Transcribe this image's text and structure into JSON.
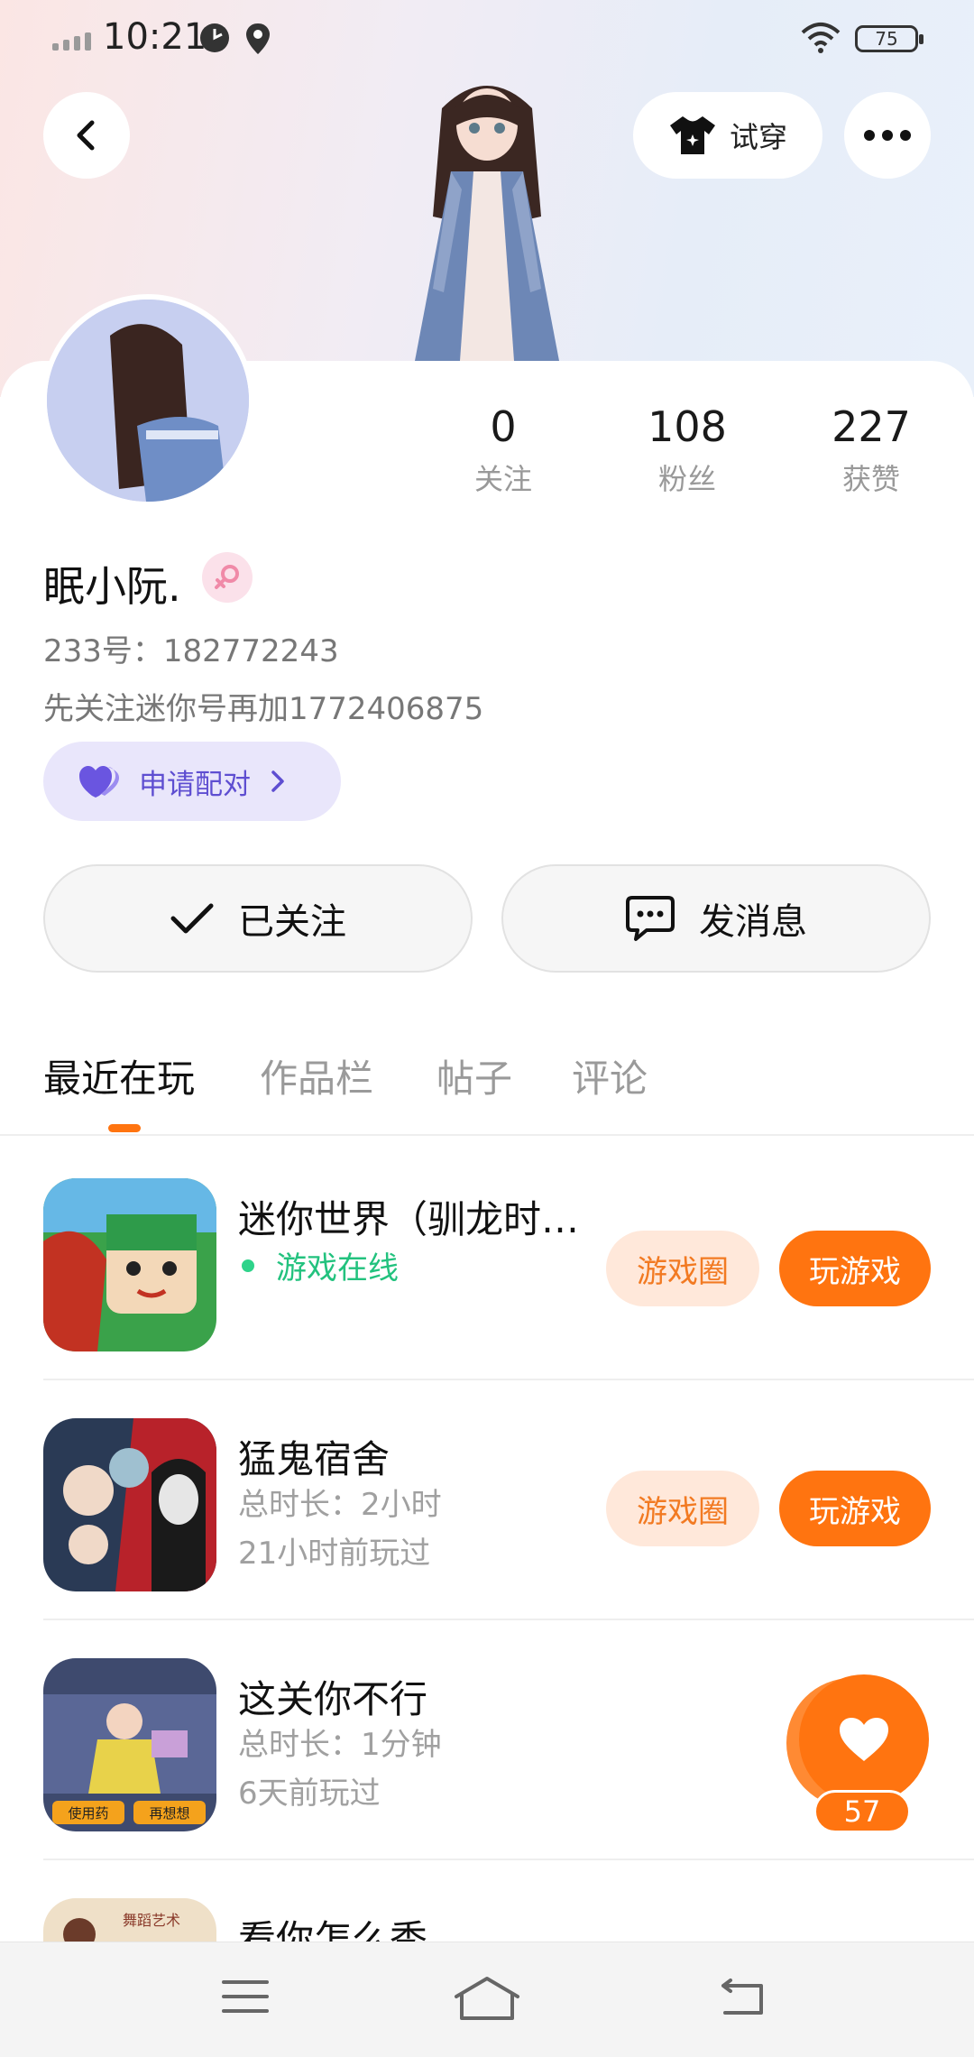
{
  "status_bar": {
    "time": "10:21",
    "battery": "75",
    "icons": [
      "signal-icon",
      "clock-icon",
      "location-icon",
      "wifi-icon",
      "battery-icon"
    ]
  },
  "header": {
    "back_icon": "chevron-left-icon",
    "try_on_label": "试穿",
    "try_on_icon": "tshirt-icon",
    "more_icon": "more-dots-icon"
  },
  "profile": {
    "nickname": "眠小阮.",
    "gender_icon": "female-icon",
    "id_line": "233号：182772243",
    "bio": "先关注迷你号再加1772406875",
    "pair_button": "申请配对",
    "stats": [
      {
        "value": "0",
        "label": "关注"
      },
      {
        "value": "108",
        "label": "粉丝"
      },
      {
        "value": "227",
        "label": "获赞"
      }
    ]
  },
  "actions": {
    "followed_label": "已关注",
    "message_label": "发消息"
  },
  "tabs": [
    {
      "label": "最近在玩",
      "active": true
    },
    {
      "label": "作品栏",
      "active": false
    },
    {
      "label": "帖子",
      "active": false
    },
    {
      "label": "评论",
      "active": false
    }
  ],
  "games": [
    {
      "title": "迷你世界（驯龙时…",
      "status": "游戏在线",
      "circle_label": "游戏圈",
      "play_label": "玩游戏"
    },
    {
      "title": "猛鬼宿舍",
      "duration": "总时长：2小时",
      "last_played": "21小时前玩过",
      "circle_label": "游戏圈",
      "play_label": "玩游戏"
    },
    {
      "title": "这关你不行",
      "duration": "总时长：1分钟",
      "last_played": "6天前玩过",
      "icon_label_left": "使用药",
      "icon_label_right": "再想想"
    },
    {
      "title": "看你怎么秀"
    }
  ],
  "floating_like": {
    "count": "57",
    "icon": "heart-icon"
  },
  "nav_bar": {
    "icons": [
      "menu-icon",
      "home-icon",
      "back-icon"
    ]
  },
  "colors": {
    "accent": "#ff7410",
    "pair_purple": "#5e4ed1",
    "online_green": "#22c27e"
  }
}
